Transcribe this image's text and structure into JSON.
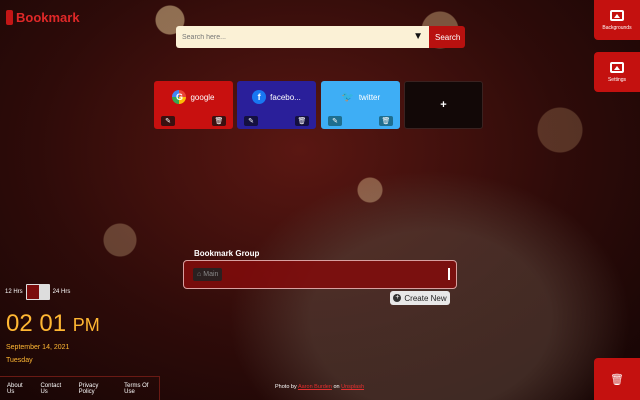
{
  "brand": {
    "name": "Bookmark"
  },
  "search": {
    "placeholder": "Search here...",
    "button_label": "Search",
    "engine_caret": "▼"
  },
  "side_panel": {
    "backgrounds_label": "Backgrounds",
    "settings_label": "Settings",
    "delete_icon": "trash-icon"
  },
  "bookmarks": [
    {
      "name": "google",
      "logo": "G",
      "color": "#c8100f"
    },
    {
      "name": "facebo...",
      "logo": "f",
      "color": "#2a1f9a"
    },
    {
      "name": "twitter",
      "logo": "🐦",
      "color": "#3eaef5"
    }
  ],
  "add_card": {
    "label": "+"
  },
  "card_actions": {
    "edit": "✎",
    "delete": "🗑"
  },
  "bookmark_group": {
    "title": "Bookmark Group",
    "selected": "Main",
    "create_label": "Create New"
  },
  "clock": {
    "label_12": "12 Hrs",
    "label_24": "24 Hrs",
    "time": "02 01",
    "ampm": "PM",
    "date": "September 14, 2021",
    "day": "Tuesday"
  },
  "footer": {
    "links": [
      "About Us",
      "Contact Us",
      "Privacy Policy",
      "Terms Of Use"
    ]
  },
  "credit": {
    "prefix": "Photo by",
    "author": "Aaron Burden",
    "middle": "on",
    "site": "Unsplash"
  },
  "colors": {
    "accent": "#c4110f",
    "clock": "#ffb733"
  }
}
